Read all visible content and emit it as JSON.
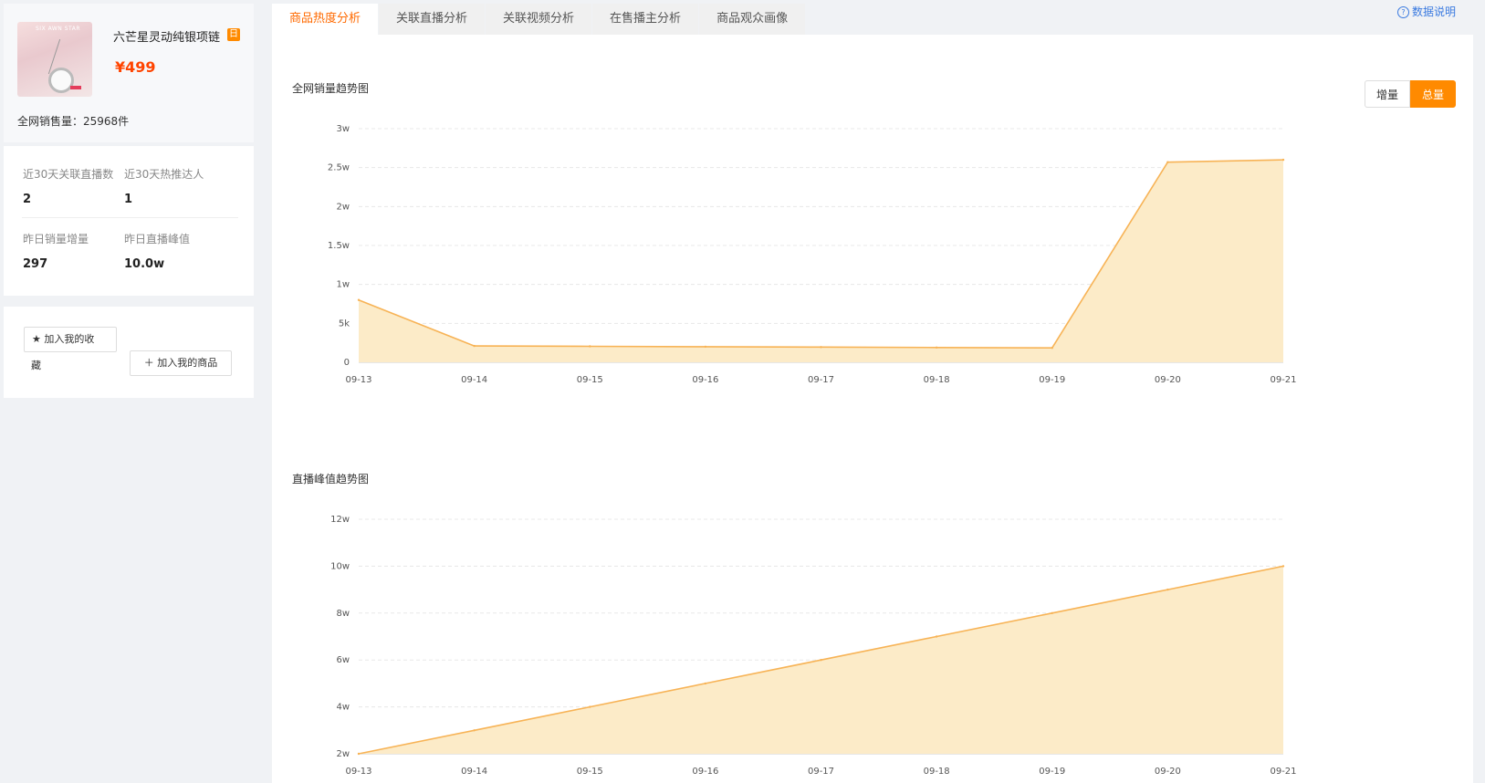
{
  "product": {
    "title": "六芒星灵动纯银项链",
    "badge": "日",
    "price": "¥499",
    "sales_line": "全网销售量：25968件",
    "thumb_text": "SIX AWN STAR"
  },
  "stats": [
    {
      "label": "近30天关联直播数",
      "value": "2"
    },
    {
      "label": "近30天热推达人",
      "value": "1"
    },
    {
      "label": "昨日销量增量",
      "value": "297"
    },
    {
      "label": "昨日直播峰值",
      "value": "10.0w"
    }
  ],
  "actions": {
    "favorite_label": "加入我的收",
    "favorite_label_wrap": "藏",
    "add_label": "加入我的商品"
  },
  "tabs": [
    "商品热度分析",
    "关联直播分析",
    "关联视频分析",
    "在售播主分析",
    "商品观众画像"
  ],
  "help_label": "数据说明",
  "toggle": {
    "increment": "增量",
    "total": "总量",
    "selected": "总量"
  },
  "colors": {
    "accent": "#ff8a00",
    "area_fill": "#fcebc8",
    "line": "#f7b356"
  },
  "chart_data": [
    {
      "type": "area",
      "title": "全网销量趋势图",
      "x": [
        "09-13",
        "09-14",
        "09-15",
        "09-16",
        "09-17",
        "09-18",
        "09-19",
        "09-20",
        "09-21"
      ],
      "values": [
        8000,
        2100,
        2050,
        2000,
        1950,
        1900,
        1850,
        25700,
        26000
      ],
      "ylim": [
        0,
        30000
      ],
      "yticks": [
        "0",
        "5k",
        "1w",
        "1.5w",
        "2w",
        "2.5w",
        "3w"
      ],
      "grid": true
    },
    {
      "type": "area",
      "title": "直播峰值趋势图",
      "x": [
        "09-13",
        "09-14",
        "09-15",
        "09-16",
        "09-17",
        "09-18",
        "09-19",
        "09-20",
        "09-21"
      ],
      "values": [
        20000,
        30000,
        40000,
        50000,
        60000,
        70000,
        80000,
        90000,
        100000
      ],
      "ylim": [
        20000,
        120000
      ],
      "yticks": [
        "2w",
        "4w",
        "6w",
        "8w",
        "10w",
        "12w"
      ],
      "grid": true
    }
  ]
}
